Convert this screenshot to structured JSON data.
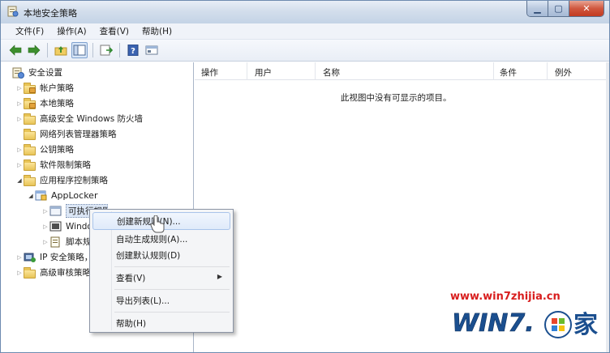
{
  "window": {
    "title": "本地安全策略"
  },
  "menubar": {
    "items": [
      "文件(F)",
      "操作(A)",
      "查看(V)",
      "帮助(H)"
    ]
  },
  "tree": [
    {
      "label": "安全设置",
      "level": 0,
      "expander": "",
      "icon": "security-settings-icon"
    },
    {
      "label": "帐户策略",
      "level": 1,
      "expander": "▷",
      "icon": "folder-icon"
    },
    {
      "label": "本地策略",
      "level": 1,
      "expander": "▷",
      "icon": "folder-icon"
    },
    {
      "label": "高级安全 Windows 防火墙",
      "level": 1,
      "expander": "▷",
      "icon": "folder-icon"
    },
    {
      "label": "网络列表管理器策略",
      "level": 1,
      "expander": "",
      "icon": "folder-icon"
    },
    {
      "label": "公钥策略",
      "level": 1,
      "expander": "▷",
      "icon": "folder-icon"
    },
    {
      "label": "软件限制策略",
      "level": 1,
      "expander": "▷",
      "icon": "folder-icon"
    },
    {
      "label": "应用程序控制策略",
      "level": 1,
      "expander": "◢",
      "icon": "folder-icon"
    },
    {
      "label": "AppLocker",
      "level": 2,
      "expander": "◢",
      "icon": "applocker-icon"
    },
    {
      "label": "可执行规则",
      "level": 3,
      "expander": "▷",
      "icon": "rules-icon"
    },
    {
      "label": "Windows 安装程序规则",
      "level": 3,
      "expander": "▷",
      "icon": "installer-rules-icon"
    },
    {
      "label": "脚本规则",
      "level": 3,
      "expander": "▷",
      "icon": "script-rules-icon"
    },
    {
      "label": "IP 安全策略，在 本地计算机",
      "level": 1,
      "expander": "▷",
      "icon": "ip-security-icon"
    },
    {
      "label": "高级审核策略配置",
      "level": 1,
      "expander": "▷",
      "icon": "folder-icon"
    }
  ],
  "list": {
    "columns": [
      "操作",
      "用户",
      "名称",
      "条件",
      "例外"
    ],
    "empty_message": "此视图中没有可显示的项目。"
  },
  "context_menu": {
    "items": [
      {
        "label": "创建新规则(N)...",
        "highlighted": true
      },
      {
        "label": "自动生成规则(A)..."
      },
      {
        "label": "创建默认规则(D)"
      },
      {
        "label": "查看(V)",
        "submenu": true
      },
      {
        "label": "导出列表(L)..."
      },
      {
        "label": "帮助(H)"
      }
    ]
  },
  "watermark": {
    "url": "www.win7zhijia.cn",
    "brand": "WIN7.",
    "brand_cn": "家"
  }
}
